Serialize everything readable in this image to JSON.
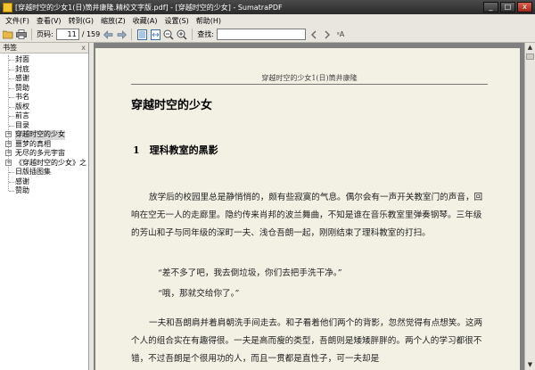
{
  "window": {
    "title": "[穿越时空的少女1(日)筒井康隆.精校文字版.pdf] - [穿越时空的少女] - SumatraPDF",
    "minimize": "_",
    "maximize": "□",
    "close": "x"
  },
  "menu": [
    "文件(F)",
    "查看(V)",
    "转到(G)",
    "缩放(Z)",
    "收藏(A)",
    "设置(S)",
    "帮助(H)"
  ],
  "toolbar": {
    "page_label": "页码:",
    "page_value": "11",
    "page_total": "/ 159",
    "find_label": "查找:",
    "find_value": ""
  },
  "sidebar": {
    "title": "书签",
    "close": "x",
    "items": [
      {
        "label": "封面",
        "level": 1,
        "expandable": false
      },
      {
        "label": "封底",
        "level": 1,
        "expandable": false
      },
      {
        "label": "感谢",
        "level": 1,
        "expandable": false
      },
      {
        "label": "赞助",
        "level": 1,
        "expandable": false
      },
      {
        "label": "书名",
        "level": 1,
        "expandable": false
      },
      {
        "label": "版权",
        "level": 1,
        "expandable": false
      },
      {
        "label": "前言",
        "level": 1,
        "expandable": false
      },
      {
        "label": "目录",
        "level": 1,
        "expandable": false
      },
      {
        "label": "穿越时空的少女",
        "level": 0,
        "expandable": true,
        "selected": true
      },
      {
        "label": "噩梦的真相",
        "level": 0,
        "expandable": true
      },
      {
        "label": "无尽的多元宇宙",
        "level": 0,
        "expandable": true
      },
      {
        "label": "《穿越时空的少女》之",
        "level": 0,
        "expandable": true
      },
      {
        "label": "日版插图集",
        "level": 1,
        "expandable": false
      },
      {
        "label": "感谢",
        "level": 1,
        "expandable": false
      },
      {
        "label": "赞助",
        "level": 1,
        "expandable": false
      }
    ]
  },
  "page": {
    "running_header": "穿越时空的少女1(日)筒井康隆",
    "book_title": "穿越时空的少女",
    "chapter_title": "1　理科教室的黑影",
    "paragraphs": [
      "放学后的校园里总是静悄悄的，颇有些寂寞的气息。偶尔会有一声开关教室门的声音，回响在空无一人的走廊里。隐约传来肖邦的波兰舞曲，不知是谁在音乐教室里弹奏钢琴。三年级的芳山和子与同年级的深町一夫、浅仓吾朗一起，刚刚结束了理科教室的打扫。",
      "“差不多了吧，我去倒垃圾，你们去把手洗干净。”",
      "“哦，那就交给你了。”",
      "一夫和吾朗肩并着肩朝洗手间走去。和子看着他们两个的背影，忽然觉得有点想笑。这两个人的组合实在有趣得很。一夫是高而瘦的类型，吾朗则是矮矮胖胖的。两个人的学习都很不错，不过吾朗是个很用功的人，而且一贯都是直性子，可一夫却是"
    ]
  },
  "colors": {
    "page_bg": "#f3f0e4",
    "doc_bg": "#808080",
    "chrome_bg": "#e8e6df",
    "titlebar_bg": "#2a2a2a"
  }
}
